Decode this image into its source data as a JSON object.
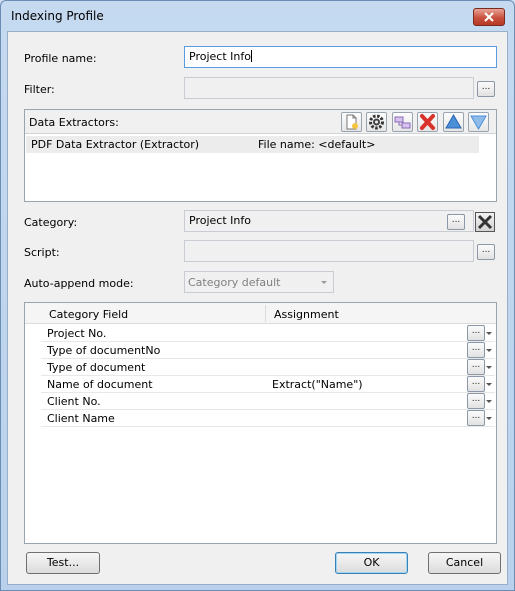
{
  "window": {
    "title": "Indexing Profile"
  },
  "profile": {
    "label": "Profile name:",
    "value": "Project Info"
  },
  "filter": {
    "label": "Filter:",
    "value": ""
  },
  "extractors": {
    "label": "Data Extractors:",
    "toolbar": [
      "new-icon",
      "gear-icon",
      "link-icon",
      "delete-icon",
      "move-up-icon",
      "move-down-icon"
    ],
    "rows": [
      {
        "name": "PDF Data Extractor (Extractor)",
        "file": "File name: <default>"
      }
    ]
  },
  "category": {
    "label": "Category:",
    "value": "Project Info"
  },
  "script": {
    "label": "Script:",
    "value": ""
  },
  "auto_append": {
    "label": "Auto-append mode:",
    "value": "Category default"
  },
  "grid": {
    "headers": {
      "field": "Category Field",
      "assignment": "Assignment"
    },
    "rows": [
      {
        "field": "Project No.",
        "assignment": ""
      },
      {
        "field": "Type of documentNo",
        "assignment": ""
      },
      {
        "field": "Type of document",
        "assignment": ""
      },
      {
        "field": "Name of document",
        "assignment": "Extract(\"Name\")"
      },
      {
        "field": "Client No.",
        "assignment": ""
      },
      {
        "field": "Client Name",
        "assignment": ""
      }
    ]
  },
  "ellipsis": "...",
  "buttons": {
    "test": "Test...",
    "ok": "OK",
    "cancel": "Cancel"
  }
}
